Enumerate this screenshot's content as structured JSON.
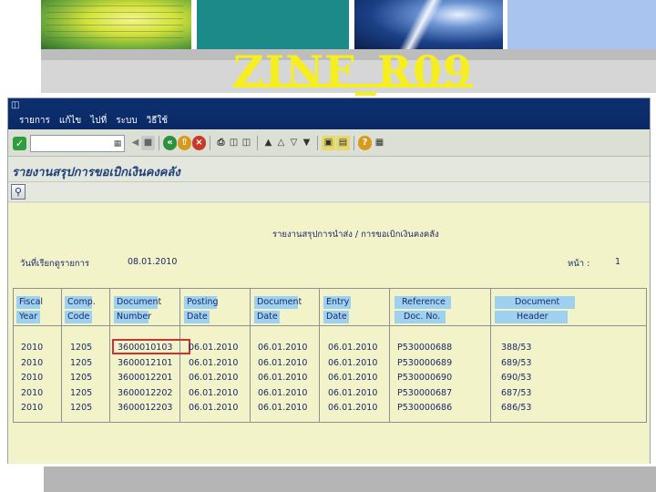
{
  "slide": {
    "title": "ZINF_R09"
  },
  "sap": {
    "menu": [
      "รายการ",
      "แก้ไข",
      "ไปที่",
      "ระบบ",
      "วิธีใช้"
    ],
    "command_field_value": "",
    "screen_title": "รายงานสรุปการขอเบิกเงินคงคลัง",
    "report": {
      "title": "รายงานสรุปการนำส่ง / การขอเบิกเงินคงคลัง",
      "date_label": "วันที่เรียกดูรายการ",
      "date_value": "08.01.2010",
      "page_label": "หน้า :",
      "page_value": "1",
      "columns": [
        {
          "line1": "Fiscal",
          "line2": "Year"
        },
        {
          "line1": "Comp.",
          "line2": "Code"
        },
        {
          "line1": "Document",
          "line2": "Number"
        },
        {
          "line1": "Posting",
          "line2": "Date"
        },
        {
          "line1": "Document",
          "line2": "Date"
        },
        {
          "line1": "Entry",
          "line2": "Date"
        },
        {
          "line1": "Reference",
          "line2": "Doc. No."
        },
        {
          "line1": "Document",
          "line2": "Header"
        }
      ],
      "rows": [
        [
          "2010",
          "1205",
          "3600010103",
          "06.01.2010",
          "06.01.2010",
          "06.01.2010",
          "P530000688",
          "388/53"
        ],
        [
          "2010",
          "1205",
          "3600012101",
          "06.01.2010",
          "06.01.2010",
          "06.01.2010",
          "P530000689",
          "689/53"
        ],
        [
          "2010",
          "1205",
          "3600012201",
          "06.01.2010",
          "06.01.2010",
          "06.01.2010",
          "P530000690",
          "690/53"
        ],
        [
          "2010",
          "1205",
          "3600012202",
          "06.01.2010",
          "06.01.2010",
          "06.01.2010",
          "P530000687",
          "687/53"
        ],
        [
          "2010",
          "1205",
          "3600012203",
          "06.01.2010",
          "06.01.2010",
          "06.01.2010",
          "P530000686",
          "686/53"
        ]
      ]
    }
  },
  "colors": {
    "title_yellow": "#f6ee1e",
    "sap_menu_blue": "#0d2f6e",
    "report_bg": "#f2f3c9",
    "header_chip": "#9ed0ef",
    "highlight_red": "#d23030"
  },
  "icons": [
    "enter-icon",
    "back-icon",
    "exit-icon",
    "cancel-icon",
    "print-icon",
    "find-icon",
    "find-next-icon",
    "first-page-icon",
    "prev-page-icon",
    "next-page-icon",
    "last-page-icon",
    "new-session-icon",
    "shortcut-icon",
    "help-icon",
    "layout-icon",
    "search-icon"
  ]
}
